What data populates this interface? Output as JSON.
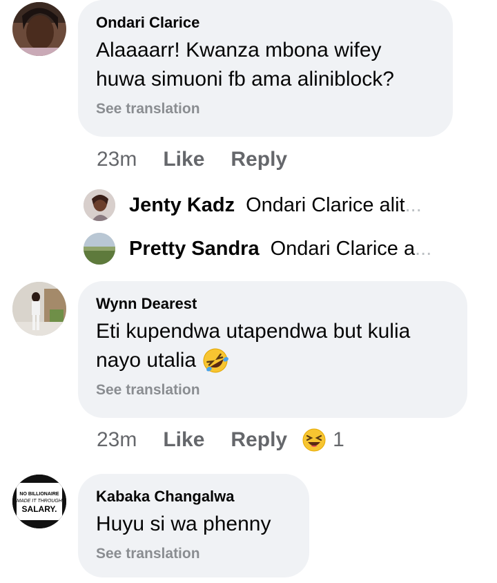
{
  "comments": [
    {
      "author": "Ondari Clarice",
      "text_line1": "Alaaaarr! Kwanza mbona wifey",
      "text_line2": "huwa simuoni fb ama aliniblock?",
      "see_translation": "See translation",
      "time": "23m",
      "like": "Like",
      "reply": "Reply"
    },
    {
      "author": "Wynn Dearest",
      "text_line1": "Eti kupendwa utapendwa but kulia",
      "text_line2": "nayo utalia",
      "emoji": "rolling-on-floor-laughing-emoji",
      "see_translation": "See translation",
      "time": "23m",
      "like": "Like",
      "reply": "Reply",
      "reaction_emoji": "laughing-squint-emoji",
      "reaction_count": "1"
    },
    {
      "author": "Kabaka Changalwa",
      "text_line1": "Huyu si wa phenny",
      "see_translation": "See translation",
      "avatar_text1": "NO BILLIONAIRE",
      "avatar_text2": "MADE IT THROUGH",
      "avatar_text3": "SALARY."
    }
  ],
  "replies": [
    {
      "name": "Jenty Kadz",
      "text": "Ondari Clarice alit",
      "ellipsis": "..."
    },
    {
      "name": "Pretty Sandra",
      "text": "Ondari Clarice a",
      "ellipsis": "..."
    }
  ]
}
